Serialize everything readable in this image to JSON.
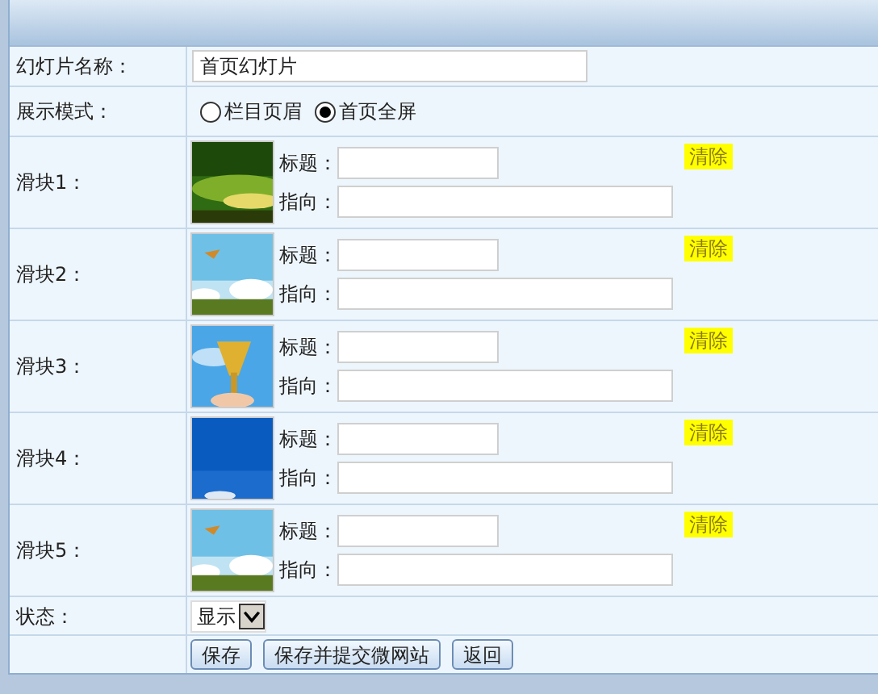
{
  "form": {
    "name_label": "幻灯片名称：",
    "name_value": "首页幻灯片",
    "mode_label": "展示模式：",
    "modes": [
      {
        "label": "栏目页眉",
        "selected": false
      },
      {
        "label": "首页全屏",
        "selected": true
      }
    ],
    "slides": [
      {
        "label": "滑块1：",
        "title_label": "标题：",
        "link_label": "指向：",
        "clear": "清除"
      },
      {
        "label": "滑块2：",
        "title_label": "标题：",
        "link_label": "指向：",
        "clear": "清除"
      },
      {
        "label": "滑块3：",
        "title_label": "标题：",
        "link_label": "指向：",
        "clear": "清除"
      },
      {
        "label": "滑块4：",
        "title_label": "标题：",
        "link_label": "指向：",
        "clear": "清除"
      },
      {
        "label": "滑块5：",
        "title_label": "标题：",
        "link_label": "指向：",
        "clear": "清除"
      }
    ],
    "status_label": "状态：",
    "status_value": "显示",
    "buttons": [
      "保存",
      "保存并提交微网站",
      "返回"
    ]
  }
}
